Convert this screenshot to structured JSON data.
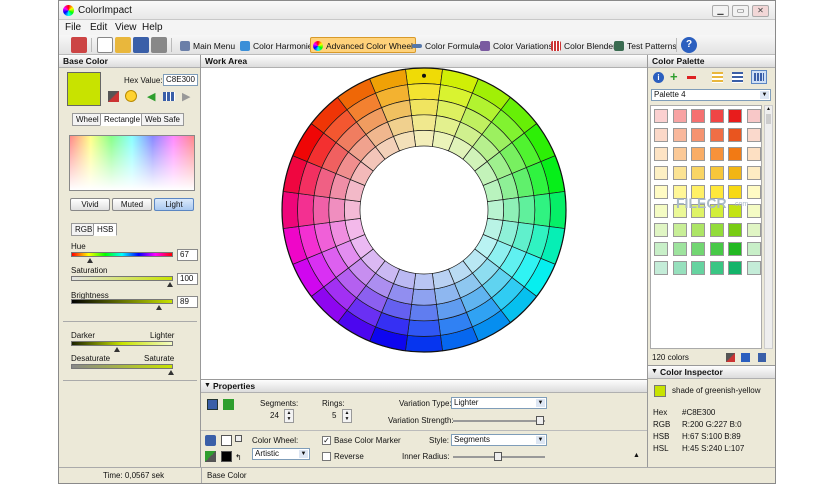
{
  "window": {
    "title": "ColorImpact"
  },
  "menu": [
    "File",
    "Edit",
    "View",
    "Help"
  ],
  "toolbar": {
    "items": [
      {
        "label": "Main Menu",
        "color": "#6b7fa8"
      },
      {
        "label": "Color Harmonies",
        "color": "#3b8fd8"
      },
      {
        "label": "Advanced Color Wheel",
        "color": "#e84",
        "active": true
      },
      {
        "label": "Color Formulae",
        "color": "#5577aa"
      },
      {
        "label": "Color Variations",
        "color": "#7a5aa0"
      },
      {
        "label": "Color Blender",
        "color": "#c33"
      },
      {
        "label": "Test Patterns",
        "color": "#3a6b50"
      }
    ]
  },
  "base_color": {
    "title": "Base Color",
    "hex_label": "Hex Value:",
    "hex_value": "C8E300",
    "swatch": "#c8e300",
    "tabs": [
      "Wheel",
      "Rectangle",
      "Web Safe"
    ],
    "active_tab": "Rectangle",
    "buttons": [
      "Vivid",
      "Muted",
      "Light"
    ],
    "active_button": "Light",
    "model_tabs": [
      "RGB",
      "HSB"
    ],
    "active_model_tab": "HSB",
    "hue_label": "Hue",
    "hue_value": "67",
    "saturation_label": "Saturation",
    "saturation_value": "100",
    "brightness_label": "Brightness",
    "brightness_value": "89",
    "darker_label": "Darker",
    "lighter_label": "Lighter",
    "desaturate_label": "Desaturate",
    "saturate_label": "Saturate"
  },
  "work_area": {
    "title": "Work Area"
  },
  "properties": {
    "title": "Properties",
    "segments_label": "Segments:",
    "segments_value": "24",
    "rings_label": "Rings:",
    "rings_value": "5",
    "variation_type_label": "Variation Type:",
    "variation_type_value": "Lighter",
    "variation_strength_label": "Variation Strength:",
    "color_wheel_label": "Color Wheel:",
    "color_wheel_value": "Artistic",
    "base_color_marker_label": "Base Color Marker",
    "base_color_marker_checked": true,
    "reverse_label": "Reverse",
    "reverse_checked": false,
    "style_label": "Style:",
    "style_value": "Segments",
    "inner_radius_label": "Inner Radius:"
  },
  "palette": {
    "title": "Color Palette",
    "selected": "Palette 4",
    "count": "120 colors",
    "watermark": "FILECR",
    "watermark_sub": ".com",
    "rows": [
      [
        "#fbd0d0",
        "#f8a3a3",
        "#f57070",
        "#f04545",
        "#e81c1c",
        "#f8c8c8"
      ],
      [
        "#fbd8c8",
        "#f9b89c",
        "#f59370",
        "#f06e45",
        "#e9551f",
        "#fad9cc"
      ],
      [
        "#fde3c4",
        "#fbc997",
        "#f9ad66",
        "#f7923a",
        "#f27a14",
        "#fde0c3"
      ],
      [
        "#fdf0c4",
        "#fbe394",
        "#f9d565",
        "#f7c73a",
        "#f2b514",
        "#fdecc3"
      ],
      [
        "#fffbc4",
        "#fff697",
        "#fff066",
        "#ffe83a",
        "#f7d914",
        "#fffbc4"
      ],
      [
        "#f4fbc4",
        "#ebf897",
        "#dff366",
        "#d2ee3a",
        "#c3e314",
        "#f4fbc4"
      ],
      [
        "#e0f5c4",
        "#c8ee97",
        "#ade566",
        "#93dc3a",
        "#78cc14",
        "#e0f5c4"
      ],
      [
        "#c8efc8",
        "#9ee39e",
        "#72d672",
        "#48c948",
        "#22b822",
        "#c8efc8"
      ],
      [
        "#c4ecd8",
        "#97e0bd",
        "#66d3a0",
        "#3ac684",
        "#14b46a",
        "#c4ecd8"
      ]
    ]
  },
  "inspector": {
    "title": "Color Inspector",
    "name": "shade of greenish-yellow",
    "swatch": "#c8e300",
    "hex_label": "Hex",
    "hex": "#C8E300",
    "rgb_label": "RGB",
    "rgb": "R:200 G:227 B:0",
    "hsb_label": "HSB",
    "hsb": "H:67 S:100 B:89",
    "hsl_label": "HSL",
    "hsl": "H:45 S:240 L:107"
  },
  "status": {
    "time": "Time: 0,0567 sek",
    "panel": "Base Color"
  }
}
